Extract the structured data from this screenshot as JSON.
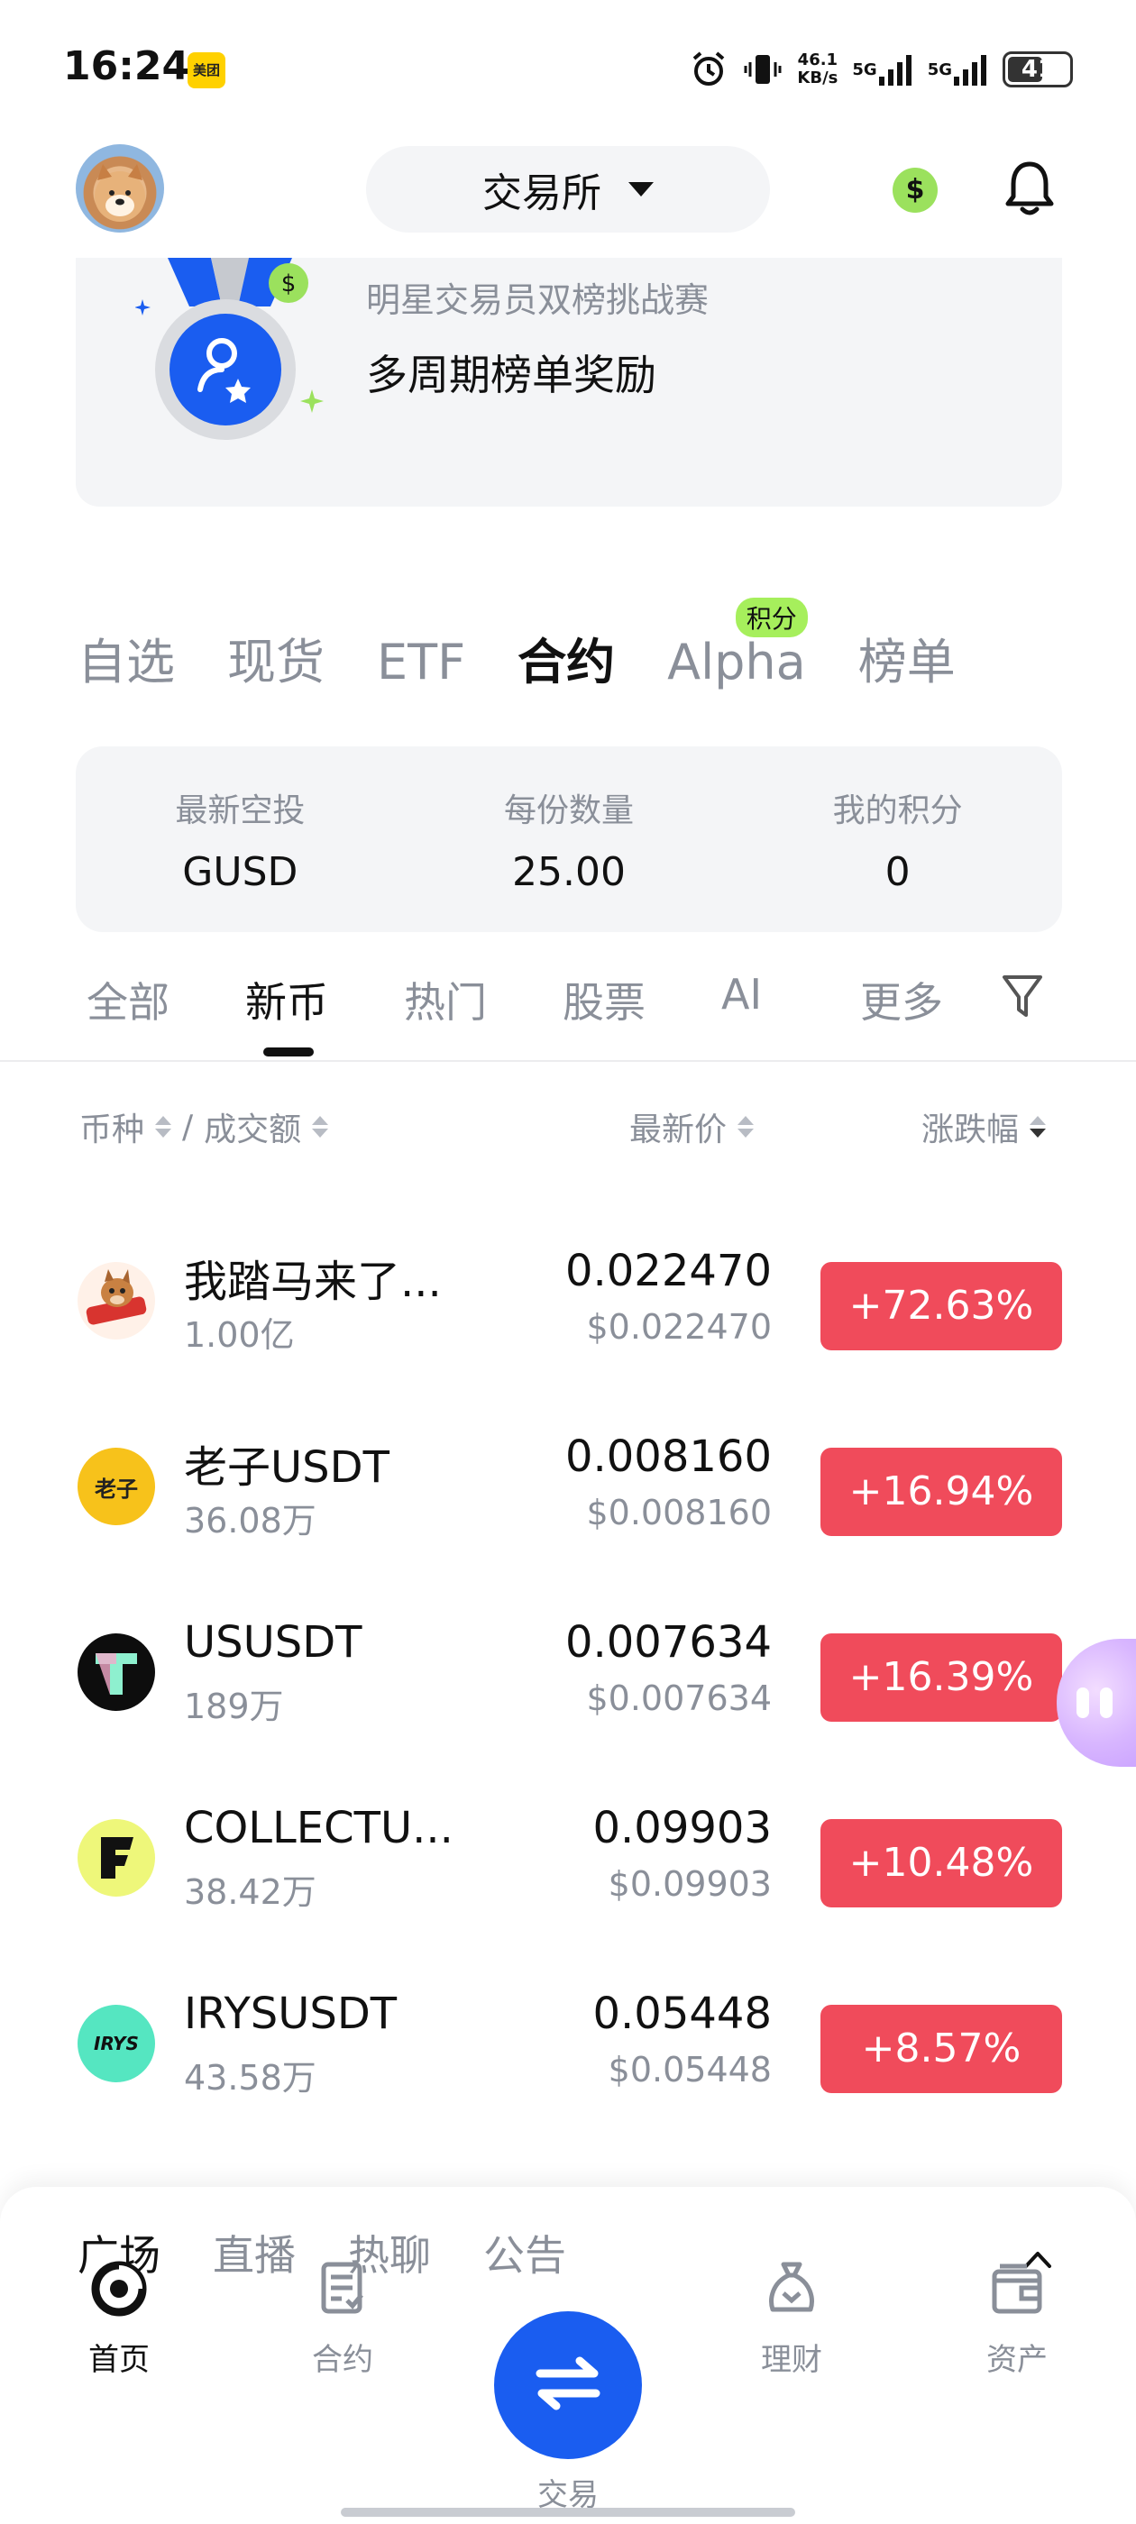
{
  "status_bar": {
    "time": "16:24",
    "app_badge": "美团",
    "net_speed_value": "46.1",
    "net_speed_unit": "KB/s",
    "signal_1": "5G",
    "signal_2": "5G",
    "battery": "41"
  },
  "header": {
    "exchange_label": "交易所",
    "dollar_symbol": "$"
  },
  "banner": {
    "subtitle": "明星交易员双榜挑战赛",
    "title": "多周期榜单奖励"
  },
  "category_tabs": [
    {
      "label": "自选"
    },
    {
      "label": "现货"
    },
    {
      "label": "ETF"
    },
    {
      "label": "合约",
      "active": true
    },
    {
      "label": "Alpha",
      "badge": "积分"
    },
    {
      "label": "榜单"
    }
  ],
  "airdrop": {
    "latest_label": "最新空投",
    "latest_value": "GUSD",
    "per_share_label": "每份数量",
    "per_share_value": "25.00",
    "points_label": "我的积分",
    "points_value": "0"
  },
  "sub_tabs": [
    {
      "label": "全部"
    },
    {
      "label": "新币",
      "active": true
    },
    {
      "label": "热门"
    },
    {
      "label": "股票"
    },
    {
      "label": "AI"
    },
    {
      "label": "更多"
    }
  ],
  "columns": {
    "coin": "币种",
    "separator": "/",
    "volume": "成交额",
    "price": "最新价",
    "change": "涨跌幅"
  },
  "rows": [
    {
      "name": "我踏马来了...",
      "volume": "1.00亿",
      "price": "0.022470",
      "usd": "$0.022470",
      "change": "+72.63%",
      "icon_text": "",
      "icon_bg": "#fff1e8"
    },
    {
      "name": "老子USDT",
      "volume": "36.08万",
      "price": "0.008160",
      "usd": "$0.008160",
      "change": "+16.94%",
      "icon_text": "老子",
      "icon_bg": "#f7c21b"
    },
    {
      "name": "USUSDT",
      "volume": "189万",
      "price": "0.007634",
      "usd": "$0.007634",
      "change": "+16.39%",
      "icon_text": "T",
      "icon_bg": "#0d0d0d"
    },
    {
      "name": "COLLECTU...",
      "volume": "38.42万",
      "price": "0.09903",
      "usd": "$0.09903",
      "change": "+10.48%",
      "icon_text": "F",
      "icon_bg": "#eef77a"
    },
    {
      "name": "IRYSUSDT",
      "volume": "43.58万",
      "price": "0.05448",
      "usd": "$0.05448",
      "change": "+8.57%",
      "icon_text": "IRYS",
      "icon_bg": "#55e6c1"
    }
  ],
  "social_tabs": [
    {
      "label": "广场",
      "active": true
    },
    {
      "label": "直播"
    },
    {
      "label": "热聊"
    },
    {
      "label": "公告"
    }
  ],
  "bottom_nav": [
    {
      "label": "首页",
      "icon": "home-icon",
      "active": true
    },
    {
      "label": "合约",
      "icon": "contract-icon"
    },
    {
      "label": "交易",
      "icon": "swap-icon"
    },
    {
      "label": "理财",
      "icon": "earn-icon"
    },
    {
      "label": "资产",
      "icon": "wallet-icon"
    }
  ],
  "colors": {
    "accent_blue": "#1a5df0",
    "change_red": "#f04b5b",
    "badge_green": "#a6ef5c"
  }
}
